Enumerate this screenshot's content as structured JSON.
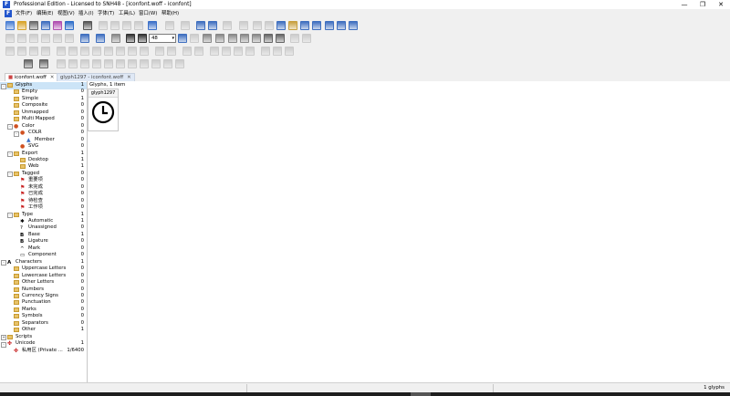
{
  "window": {
    "title": "Professional Edition - Licensed to SNH48 - [iconfont.woff - iconfont]",
    "min": "—",
    "max": "❐",
    "close": "✕"
  },
  "menu": [
    "文件(F)",
    "编辑(E)",
    "视图(V)",
    "插入(I)",
    "字体(T)",
    "工具(L)",
    "窗口(W)",
    "帮助(H)"
  ],
  "toolbar": {
    "zoom_value": "48",
    "combo_a": "T",
    "combo_b": "T",
    "combo_c": ""
  },
  "tabs": [
    {
      "label": "iconfont.woff",
      "active": true,
      "close": "✕"
    },
    {
      "label": "glyph1297 - iconfont.woff",
      "active": false,
      "close": "✕"
    }
  ],
  "tree": [
    {
      "label": "Glyphs",
      "count": "1",
      "level": 0,
      "icon": "folder",
      "exp": "-",
      "selected": true
    },
    {
      "label": "Empty",
      "count": "0",
      "level": 1,
      "icon": "folder"
    },
    {
      "label": "Simple",
      "count": "1",
      "level": 1,
      "icon": "folder"
    },
    {
      "label": "Composite",
      "count": "0",
      "level": 1,
      "icon": "folder"
    },
    {
      "label": "Unmapped",
      "count": "0",
      "level": 1,
      "icon": "folder"
    },
    {
      "label": "Multi Mapped",
      "count": "0",
      "level": 1,
      "icon": "folder"
    },
    {
      "label": "Color",
      "count": "0",
      "level": 1,
      "icon": "color",
      "exp": "-"
    },
    {
      "label": "COLR",
      "count": "0",
      "level": 2,
      "icon": "color",
      "exp": "-"
    },
    {
      "label": "Member",
      "count": "0",
      "level": 3,
      "icon": "member"
    },
    {
      "label": "SVG",
      "count": "0",
      "level": 2,
      "icon": "color"
    },
    {
      "label": "Export",
      "count": "1",
      "level": 1,
      "icon": "folder",
      "exp": "-"
    },
    {
      "label": "Desktop",
      "count": "1",
      "level": 2,
      "icon": "folder"
    },
    {
      "label": "Web",
      "count": "1",
      "level": 2,
      "icon": "folder"
    },
    {
      "label": "Tagged",
      "count": "0",
      "level": 1,
      "icon": "folder",
      "exp": "-"
    },
    {
      "label": "重要项",
      "count": "0",
      "level": 2,
      "icon": "flag-red"
    },
    {
      "label": "未完成",
      "count": "0",
      "level": 2,
      "icon": "flag-red"
    },
    {
      "label": "已完成",
      "count": "0",
      "level": 2,
      "icon": "flag-red"
    },
    {
      "label": "待检查",
      "count": "0",
      "level": 2,
      "icon": "flag-red"
    },
    {
      "label": "工作项",
      "count": "0",
      "level": 2,
      "icon": "flag-red"
    },
    {
      "label": "Type",
      "count": "1",
      "level": 1,
      "icon": "folder",
      "exp": "-"
    },
    {
      "label": "Automatic",
      "count": "1",
      "level": 2,
      "icon": "type-auto"
    },
    {
      "label": "Unassigned",
      "count": "0",
      "level": 2,
      "icon": "type-q"
    },
    {
      "label": "Base",
      "count": "1",
      "level": 2,
      "icon": "type-b"
    },
    {
      "label": "Ligature",
      "count": "0",
      "level": 2,
      "icon": "type-b"
    },
    {
      "label": "Mark",
      "count": "0",
      "level": 2,
      "icon": "type-mark"
    },
    {
      "label": "Component",
      "count": "0",
      "level": 2,
      "icon": "type-comp"
    },
    {
      "label": "Characters",
      "count": "1",
      "level": 0,
      "icon": "chars",
      "exp": "-"
    },
    {
      "label": "Uppercase Letters",
      "count": "0",
      "level": 1,
      "icon": "folder"
    },
    {
      "label": "Lowercase Letters",
      "count": "0",
      "level": 1,
      "icon": "folder"
    },
    {
      "label": "Other Letters",
      "count": "0",
      "level": 1,
      "icon": "folder"
    },
    {
      "label": "Numbers",
      "count": "0",
      "level": 1,
      "icon": "folder"
    },
    {
      "label": "Currency Signs",
      "count": "0",
      "level": 1,
      "icon": "folder"
    },
    {
      "label": "Punctuation",
      "count": "0",
      "level": 1,
      "icon": "folder"
    },
    {
      "label": "Marks",
      "count": "0",
      "level": 1,
      "icon": "folder"
    },
    {
      "label": "Symbols",
      "count": "0",
      "level": 1,
      "icon": "folder"
    },
    {
      "label": "Separators",
      "count": "0",
      "level": 1,
      "icon": "folder"
    },
    {
      "label": "Other",
      "count": "1",
      "level": 1,
      "icon": "folder"
    },
    {
      "label": "Scripts",
      "count": "",
      "level": 0,
      "icon": "folder",
      "exp": "+"
    },
    {
      "label": "Unicode",
      "count": "1",
      "level": 0,
      "icon": "unicode",
      "exp": "-"
    },
    {
      "label": "私用区 (Private ...",
      "count": "1/6400",
      "level": 1,
      "icon": "unicode"
    }
  ],
  "main": {
    "header": "Glyphs, 1 item",
    "glyph_cell_label": "glyph1297",
    "glyph_icon": "clock-icon"
  },
  "status": {
    "text": "1 glyphs"
  }
}
